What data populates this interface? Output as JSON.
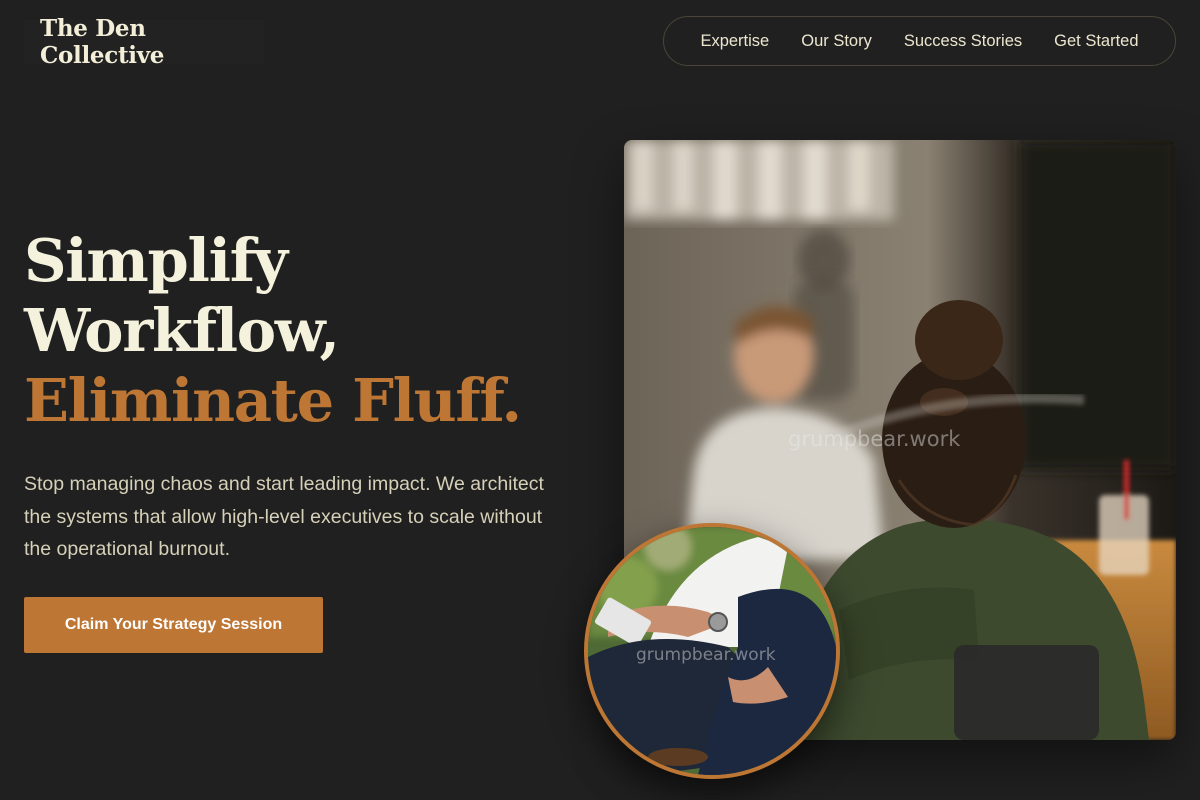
{
  "brand": {
    "name": "The Den Collective"
  },
  "nav": {
    "items": [
      {
        "label": "Expertise"
      },
      {
        "label": "Our Story"
      },
      {
        "label": "Success Stories"
      },
      {
        "label": "Get Started"
      }
    ]
  },
  "hero": {
    "headline_line1": "Simplify",
    "headline_line2": "Workflow,",
    "headline_accent": "Eliminate Fluff.",
    "subtext": "Stop managing chaos and start leading impact. We architect the systems that allow high-level executives to scale without the operational burnout.",
    "cta_label": "Claim Your Strategy Session"
  },
  "images": {
    "main_watermark": "grumpbear.work",
    "inset_watermark": "grumpbear.work"
  },
  "colors": {
    "background": "#202020",
    "accent": "#bd7634",
    "headline_text": "#f4f1dc",
    "body_text": "#d6d0b8"
  }
}
